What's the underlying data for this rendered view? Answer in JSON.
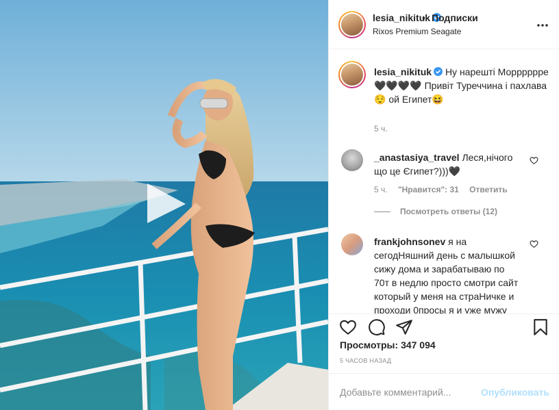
{
  "header": {
    "username": "lesia_nikituk",
    "separator": "•",
    "follow_label": "Подписки",
    "location": "Rixos Premium Seagate"
  },
  "caption": {
    "username": "lesia_nikituk",
    "text": "Ну нарешті Морррррре🖤🖤🖤🖤 Привіт Туреччина і пахлава😌 ой Египет😆",
    "time": "5 ч."
  },
  "comments": [
    {
      "username": "_anastasiya_travel",
      "text": "Леся,нічого що це Єгипет?)))🖤",
      "time": "5 ч.",
      "likes": "\"Нравится\": 31",
      "reply_label": "Ответить",
      "view_replies": "Посмотреть ответы (12)"
    },
    {
      "username": "frankjohnsonev",
      "text": "я на сегодНяшний день с малышкой сижу дома и зарабатываю по 70т в недлю просто смотри сайт который у меня на страНичке и проходи 0просы я и уже мужу"
    }
  ],
  "stats": {
    "views_label": "Просмотры:",
    "views_count": "347 094",
    "time_ago": "5 часов назад"
  },
  "comment_box": {
    "placeholder": "Добавьте комментарий...",
    "publish_label": "Опубликовать"
  },
  "icons": {
    "verified": "verified-badge-icon",
    "more": "more-horizontal-icon",
    "play": "play-icon",
    "heart": "heart-icon",
    "comment": "comment-icon",
    "share": "share-icon",
    "save": "bookmark-icon"
  },
  "colors": {
    "text": "#262626",
    "secondary": "#8e8e8e",
    "verified": "#3897f0",
    "publish_disabled": "#b2dffc"
  }
}
